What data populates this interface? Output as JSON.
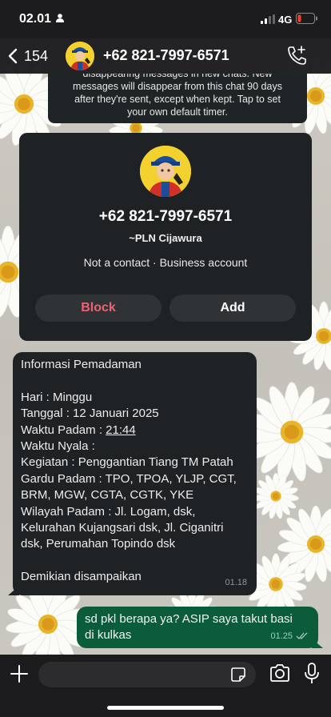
{
  "status_bar": {
    "time": "02.01",
    "network": "4G"
  },
  "header": {
    "back_count": "154",
    "contact_title": "+62 821-7997-6571"
  },
  "notice": {
    "lines": [
      "disappearing messages in new chats. New",
      "messages will disappear from this chat 90 days",
      "after they're sent, except when kept. Tap to set",
      "your own default timer."
    ]
  },
  "business_card": {
    "phone": "+62 821-7997-6571",
    "name": "~PLN Cijawura",
    "meta": "Not a contact · Business account",
    "block_label": "Block",
    "add_label": "Add"
  },
  "incoming_message": {
    "lines": [
      "Informasi Pemadaman",
      "",
      "Hari : Minggu",
      "Tanggal : 12 Januari 2025",
      "Waktu Padam : ",
      "Waktu Nyala :",
      "Kegiatan : Penggantian Tiang TM Patah",
      "Gardu Padam : TPO, TPOA, YLJP, CGT,",
      "BRM, MGW, CGTA, CGTK, YKE",
      "Wilayah Padam : Jl. Logam, dsk,",
      "Kelurahan Kujangsari dsk, Jl. Ciganitri",
      "dsk, Perumahan Topindo dsk",
      "",
      "Demikian disampaikan"
    ],
    "outage_time": "21:44",
    "time": "01.18"
  },
  "outgoing_message": {
    "lines": [
      "sd pkl berapa ya? ASIP saya takut basi",
      "di kulkas"
    ],
    "time": "01.25"
  },
  "input": {
    "placeholder": ""
  },
  "colors": {
    "block_red": "#ee6272",
    "outgoing_green": "#0b5c3a",
    "bubble_dark": "#1f2224"
  }
}
